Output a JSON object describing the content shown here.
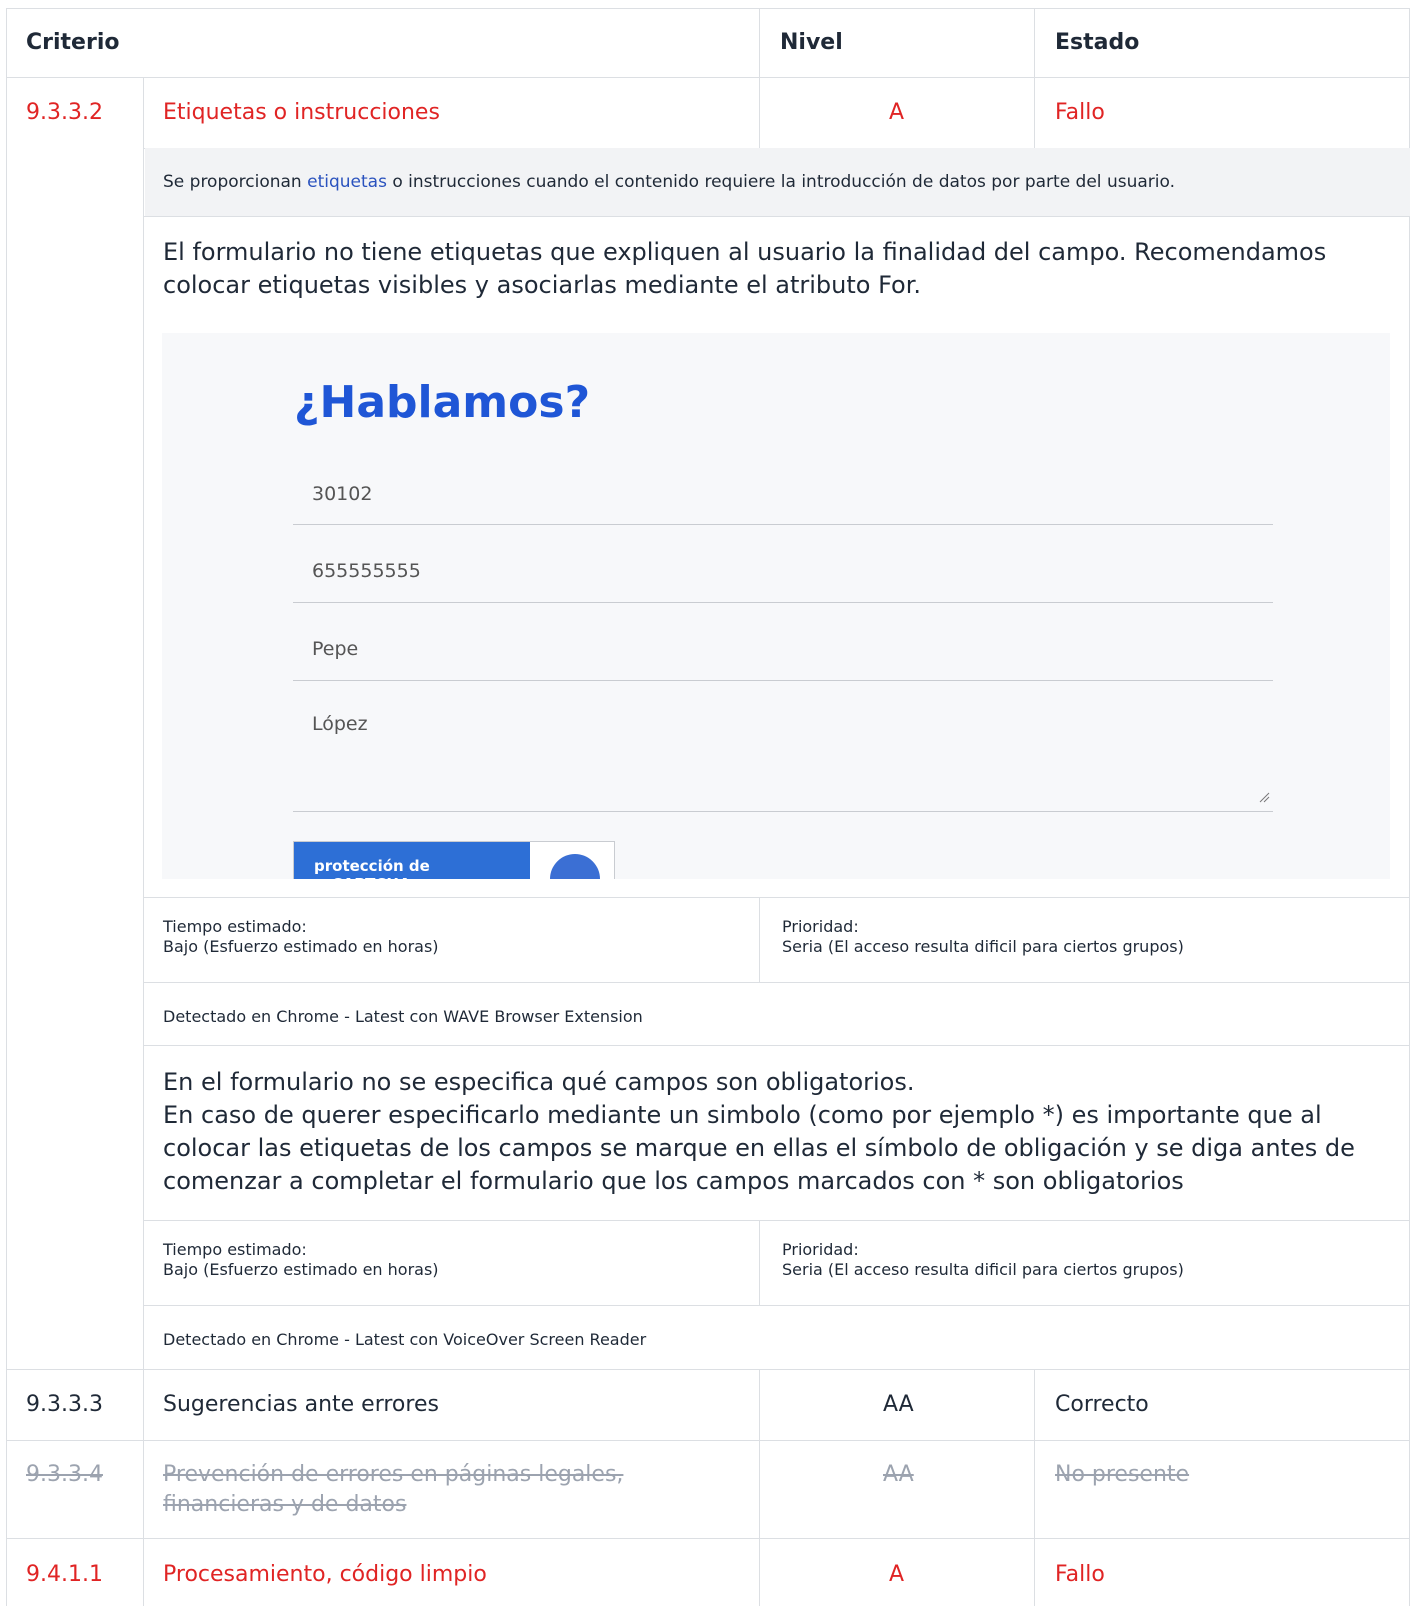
{
  "headers": {
    "criterio": "Criterio",
    "nivel": "Nivel",
    "estado": "Estado"
  },
  "rows": [
    {
      "code": "9.3.3.2",
      "name": "Etiquetas o instrucciones",
      "level": "A",
      "status": "Fallo"
    },
    {
      "code": "9.3.3.3",
      "name": "Sugerencias ante errores",
      "level": "AA",
      "status": "Correcto"
    },
    {
      "code": "9.3.3.4",
      "name_line1": "Prevención de errores en páginas legales,",
      "name_line2": "financieras y de datos",
      "level": "AA",
      "status": "No presente"
    },
    {
      "code": "9.4.1.1",
      "name": "Procesamiento, código limpio",
      "level": "A",
      "status": "Fallo"
    }
  ],
  "hint": {
    "before": "Se proporcionan ",
    "link": "etiquetas",
    "after": " o instrucciones cuando el contenido requiere la introducción de datos por parte del usuario."
  },
  "issue1": {
    "text": "El formulario no tiene etiquetas que expliquen al usuario la finalidad del campo. Recomendamos colocar etiquetas visibles y asociarlas mediante el atributo For.",
    "screenshot": {
      "title": "¿Hablamos?",
      "fields": [
        "30102",
        "655555555",
        "Pepe",
        "López"
      ],
      "recaptcha": "protección de reCAPTCHA"
    },
    "time_label": "Tiempo estimado:",
    "time_value": "Bajo (Esfuerzo estimado en horas)",
    "priority_label": "Prioridad:",
    "priority_value": "Seria (El acceso resulta dificil para ciertos grupos)",
    "detected": "Detectado en Chrome - Latest con WAVE Browser Extension"
  },
  "issue2": {
    "line1": "En el formulario no se especifica qué campos son obligatorios.",
    "line2": "En caso de querer especificarlo mediante un simbolo (como por ejemplo *) es importante que al colocar las etiquetas de los campos se marque en ellas el símbolo de obligación y se diga antes de comenzar a completar el formulario que los campos marcados con * son obligatorios",
    "time_label": "Tiempo estimado:",
    "time_value": "Bajo (Esfuerzo estimado en horas)",
    "priority_label": "Prioridad:",
    "priority_value": "Seria (El acceso resulta dificil para ciertos grupos)",
    "detected": "Detectado en Chrome - Latest con VoiceOver Screen Reader"
  },
  "colors": {
    "fail": "#e02424",
    "link": "#2a52be",
    "form_title": "#1f56d6",
    "recaptcha": "#2d6fd6"
  }
}
